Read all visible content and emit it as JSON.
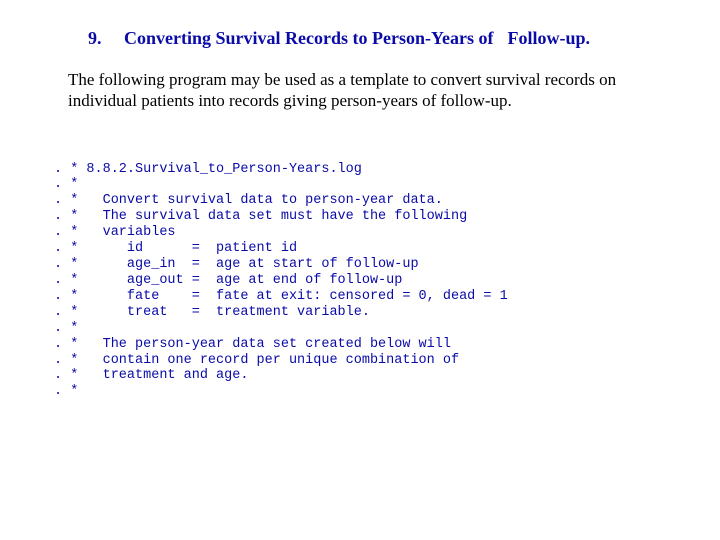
{
  "heading": {
    "number": "9.",
    "title_part1": "Converting Survival Records to Person-Years of",
    "title_part2": "Follow-up."
  },
  "intro": "The following program may be used as a template to convert survival records on individual patients into records giving person-years of follow-up.",
  "code_lines": [
    ". * 8.8.2.Survival_to_Person-Years.log",
    ". *",
    ". *   Convert survival data to person-year data.",
    ". *   The survival data set must have the following",
    ". *   variables",
    ". *      id      =  patient id",
    ". *      age_in  =  age at start of follow-up",
    ". *      age_out =  age at end of follow-up",
    ". *      fate    =  fate at exit: censored = 0, dead = 1",
    ". *      treat   =  treatment variable.",
    ". *",
    ". *   The person-year data set created below will",
    ". *   contain one record per unique combination of",
    ". *   treatment and age.",
    ". *"
  ]
}
